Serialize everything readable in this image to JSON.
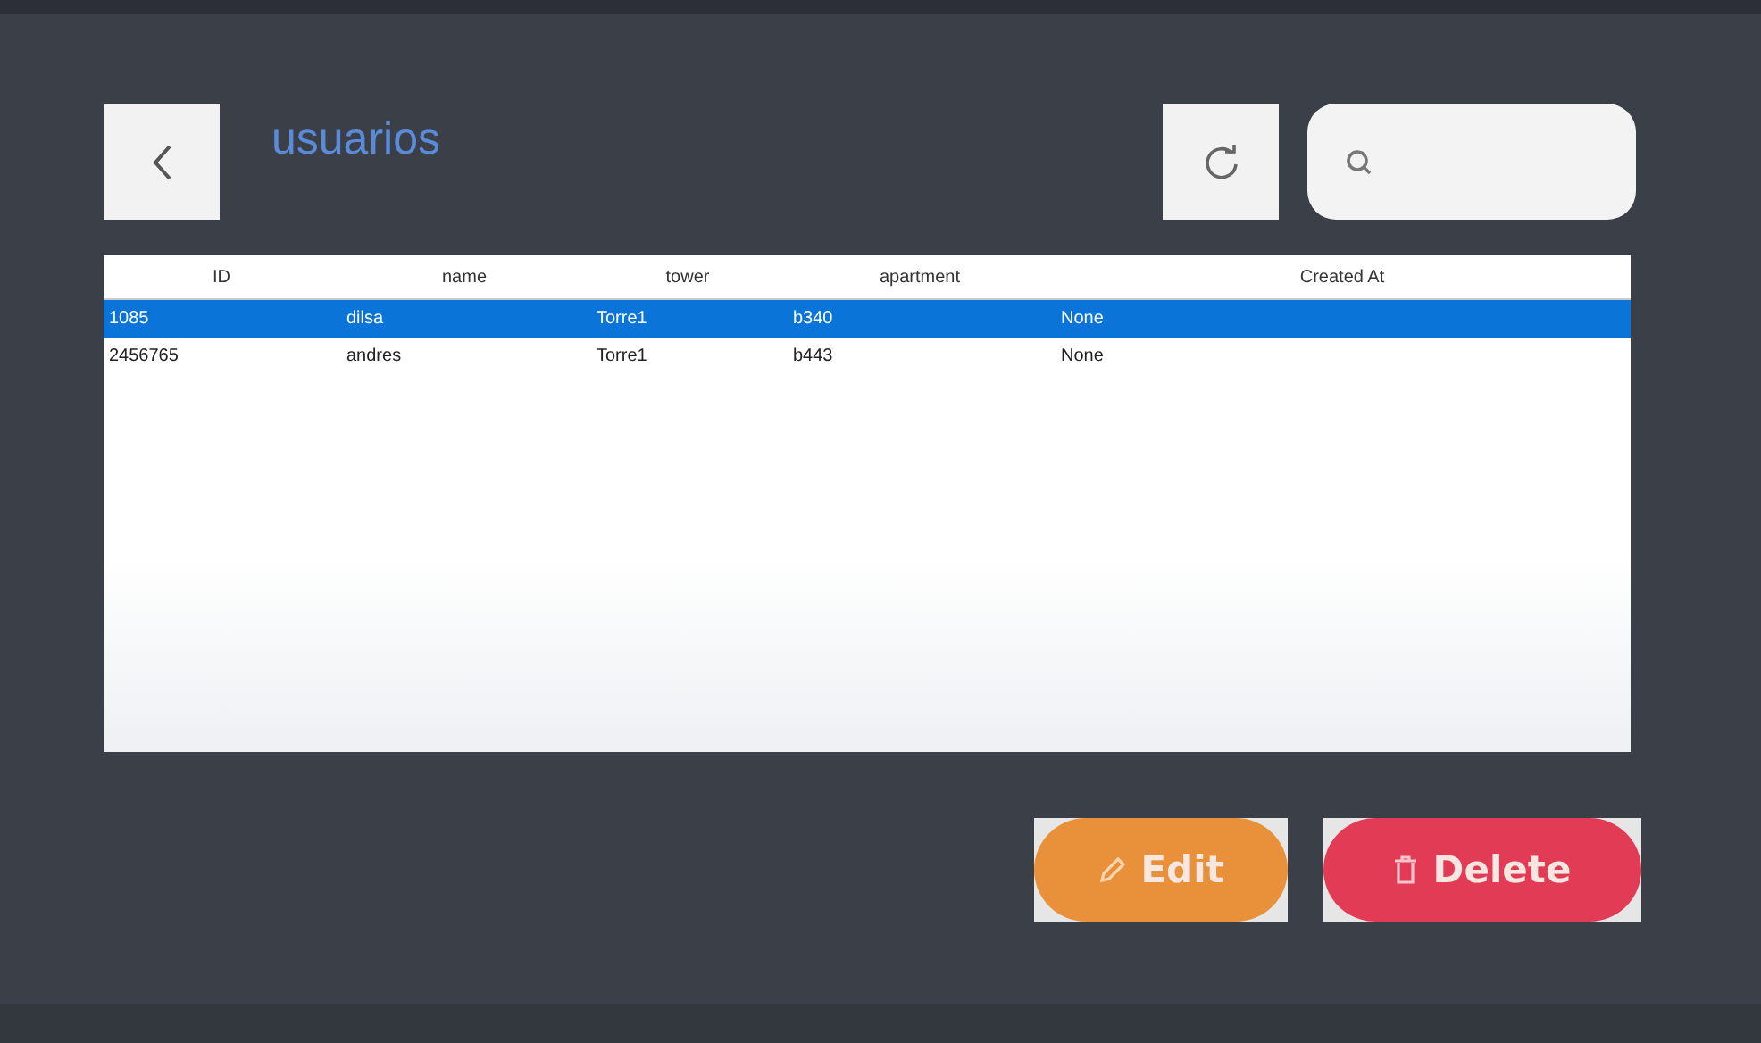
{
  "header": {
    "title": "usuarios"
  },
  "table": {
    "columns": [
      "ID",
      "name",
      "tower",
      "apartment",
      "Created At"
    ],
    "rows": [
      {
        "cells": [
          "1085",
          "dilsa",
          "Torre1",
          "b340",
          "None"
        ],
        "selected": true
      },
      {
        "cells": [
          "2456765",
          "andres",
          "Torre1",
          "b443",
          "None"
        ],
        "selected": false
      }
    ]
  },
  "buttons": [
    {
      "kind": "edit",
      "label": "Edit"
    },
    {
      "kind": "delete",
      "label": "Delete"
    }
  ]
}
